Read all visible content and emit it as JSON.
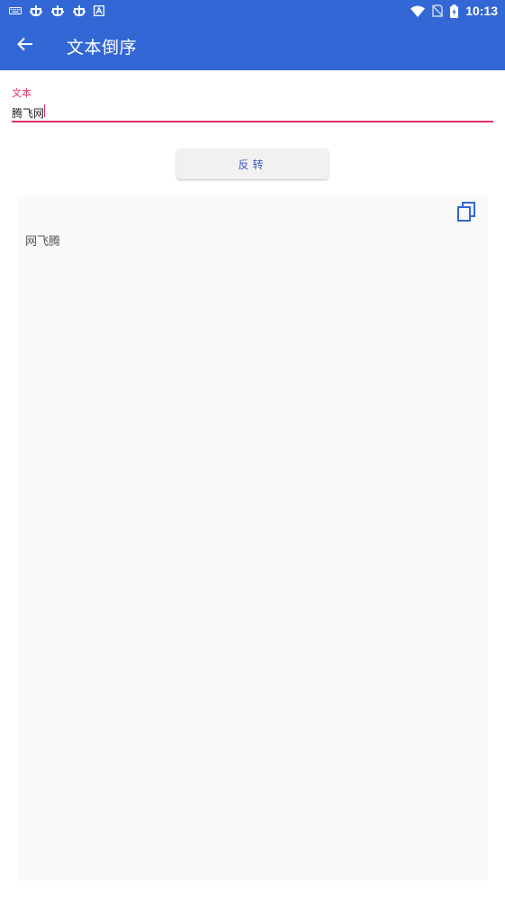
{
  "statusbar": {
    "time": "10:13",
    "left_icons": [
      "keyboard-icon",
      "bug-icon",
      "bug-icon",
      "bug-icon",
      "a-box-icon"
    ],
    "right_icons": [
      "wifi-icon",
      "no-sim-icon",
      "battery-icon"
    ]
  },
  "appbar": {
    "title": "文本倒序",
    "back_icon": "arrow-left-icon",
    "background": "#3367d6"
  },
  "input_field": {
    "label": "文本",
    "value": "腾飞网",
    "accent": "#e0306a"
  },
  "reverse_button": {
    "label": "反转",
    "text_color": "#3a57b9"
  },
  "result": {
    "text": "网飞腾",
    "copy_icon": "copy-icon",
    "icon_color": "#3367d6"
  }
}
